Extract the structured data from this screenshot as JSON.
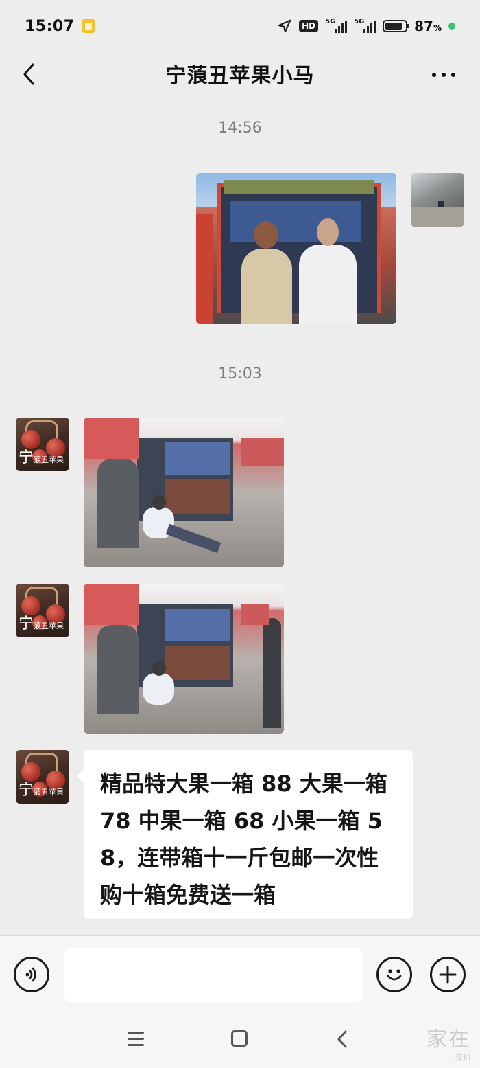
{
  "status_bar": {
    "time": "15:07",
    "network_badge": "HD",
    "signal_1_label": "5G",
    "signal_2_label": "5G",
    "battery_percent": 87,
    "battery_text": "87",
    "battery_unit": "%"
  },
  "header": {
    "title": "宁蒗丑苹果小马"
  },
  "messages": {
    "timestamp_1": "14:56",
    "timestamp_2": "15:03",
    "text_message": "精品特大果一箱 88 大果一箱 78 中果一箱 68 小果一箱 58，连带箱十一斤包邮一次性购十箱免费送一箱"
  },
  "avatar": {
    "caption_big": "宁",
    "caption_small": "蒗丑苹果"
  },
  "input": {
    "value": "",
    "placeholder": ""
  },
  "watermark": {
    "text": "家在",
    "sub": "深圳"
  },
  "colors": {
    "background": "#ededed",
    "bubble": "#ffffff",
    "charge_indicator": "#38c172"
  }
}
